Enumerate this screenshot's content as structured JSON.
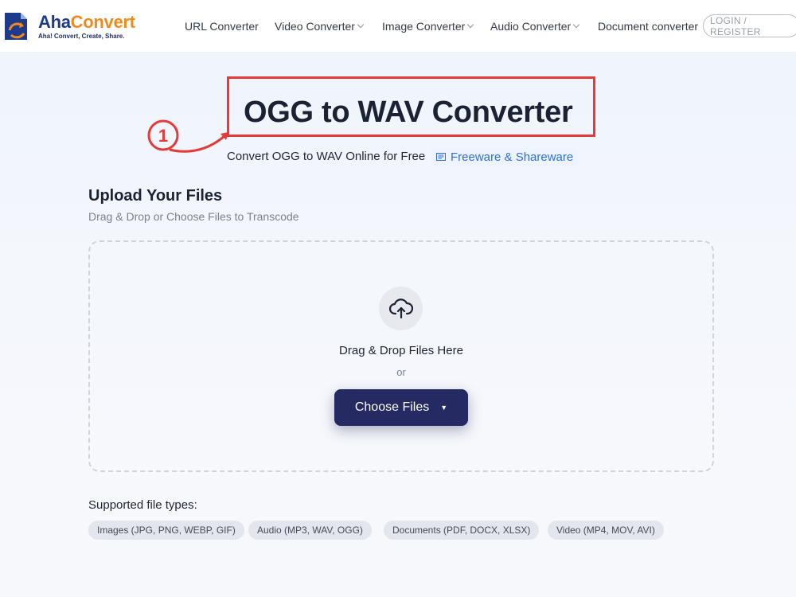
{
  "header": {
    "logo": {
      "name_part1": "Aha",
      "name_part2": "Convert",
      "tagline": "Aha! Convert, Create, Share."
    },
    "nav": [
      {
        "label": "URL Converter",
        "has_dropdown": false
      },
      {
        "label": "Video Converter",
        "has_dropdown": true
      },
      {
        "label": "Image Converter",
        "has_dropdown": true
      },
      {
        "label": "Audio Converter",
        "has_dropdown": true
      },
      {
        "label": "Document converter",
        "has_dropdown": false
      }
    ],
    "login_label": "LOGIN / REGISTER"
  },
  "hero": {
    "step_marker": "①",
    "title": "OGG to WAV Converter",
    "subtitle": "Convert OGG to WAV Online for Free",
    "freeware_label": "Freeware & Shareware",
    "highlight_color": "#e53a3a"
  },
  "upload": {
    "title": "Upload Your Files",
    "subtitle": "Drag & Drop or Choose Files to Transcode",
    "drop_text": "Drag & Drop Files Here",
    "or_text": "or",
    "choose_label": "Choose Files",
    "choose_caret": "▼",
    "button_color": "#252a63"
  },
  "supported": {
    "label": "Supported file types:",
    "types": [
      "Images (JPG, PNG, WEBP, GIF)",
      "Audio (MP3, WAV, OGG)",
      "Documents (PDF, DOCX, XLSX)",
      "Video (MP4, MOV, AVI)"
    ]
  }
}
